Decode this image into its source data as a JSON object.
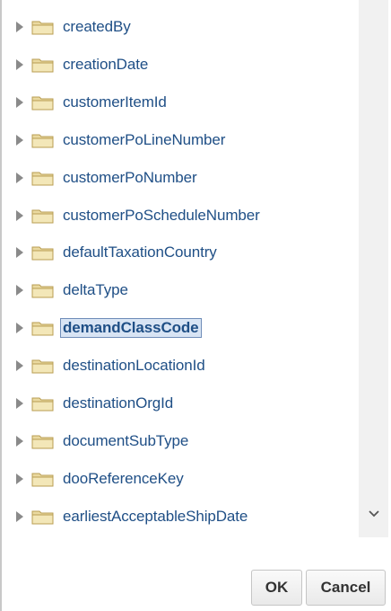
{
  "tree": {
    "items": [
      {
        "label": "createdBy",
        "selected": false
      },
      {
        "label": "creationDate",
        "selected": false
      },
      {
        "label": "customerItemId",
        "selected": false
      },
      {
        "label": "customerPoLineNumber",
        "selected": false
      },
      {
        "label": "customerPoNumber",
        "selected": false
      },
      {
        "label": "customerPoScheduleNumber",
        "selected": false
      },
      {
        "label": "defaultTaxationCountry",
        "selected": false
      },
      {
        "label": "deltaType",
        "selected": false
      },
      {
        "label": "demandClassCode",
        "selected": true
      },
      {
        "label": "destinationLocationId",
        "selected": false
      },
      {
        "label": "destinationOrgId",
        "selected": false
      },
      {
        "label": "documentSubType",
        "selected": false
      },
      {
        "label": "dooReferenceKey",
        "selected": false
      },
      {
        "label": "earliestAcceptableShipDate",
        "selected": false
      }
    ]
  },
  "scrollbar": {
    "icon": "chevron-down-icon"
  },
  "buttons": {
    "ok_label": "OK",
    "cancel_label": "Cancel"
  },
  "colors": {
    "label_text": "#1f4f86",
    "folder_fill": "#ead9a0",
    "selected_bg": "#d8e4f4",
    "scroll_track": "#f1f1f1"
  }
}
